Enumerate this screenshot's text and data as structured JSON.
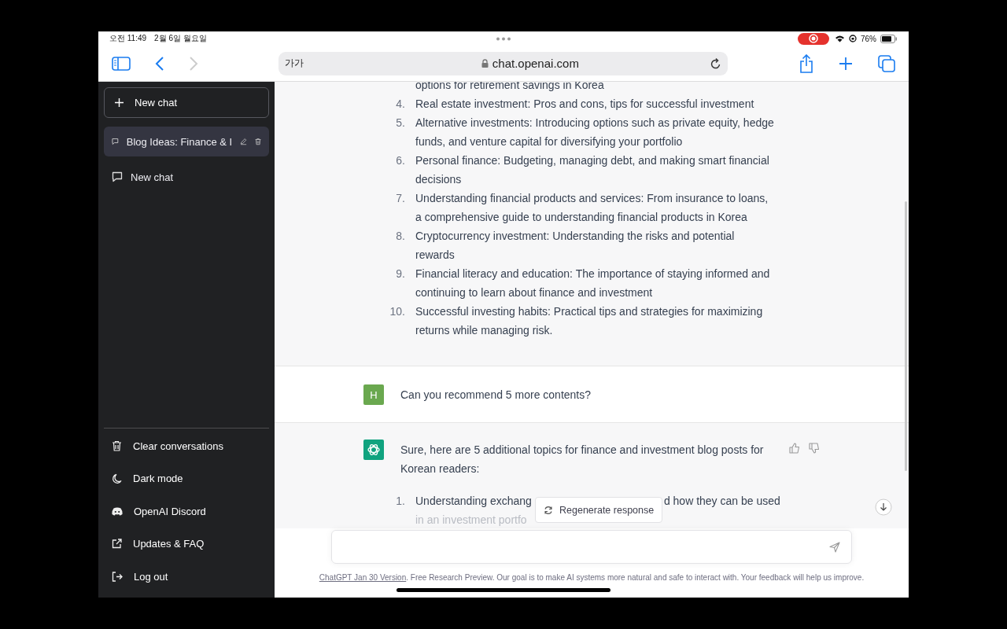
{
  "status_bar": {
    "time": "오전 11:49",
    "date": "2월 6일 월요일",
    "battery": "76%",
    "recording": true
  },
  "browser": {
    "text_size": "가가",
    "url": "chat.openai.com"
  },
  "sidebar": {
    "new_chat": "New chat",
    "chats": [
      {
        "title": "Blog Ideas: Finance & I",
        "selected": true
      },
      {
        "title": "New chat",
        "selected": false
      }
    ],
    "menu": [
      {
        "label": "Clear conversations",
        "kind": "trash"
      },
      {
        "label": "Dark mode",
        "kind": "moon"
      },
      {
        "label": "OpenAI Discord",
        "kind": "discord"
      },
      {
        "label": "Updates & FAQ",
        "kind": "external"
      },
      {
        "label": "Log out",
        "kind": "logout"
      }
    ]
  },
  "conversation": {
    "earlier_list": [
      {
        "text": "options for retirement savings in Korea"
      },
      {
        "number": "4.",
        "text": "Real estate investment: Pros and cons, tips for successful investment"
      },
      {
        "number": "5.",
        "text": "Alternative investments: Introducing options such as private equity, hedge funds, and venture capital for diversifying your portfolio"
      },
      {
        "number": "6.",
        "text": "Personal finance: Budgeting, managing debt, and making smart financial decisions"
      },
      {
        "number": "7.",
        "text": "Understanding financial products and services: From insurance to loans, a comprehensive guide to understanding financial products in Korea"
      },
      {
        "number": "8.",
        "text": "Cryptocurrency investment: Understanding the risks and potential rewards"
      },
      {
        "number": "9.",
        "text": "Financial literacy and education: The importance of staying informed and continuing to learn about finance and investment"
      },
      {
        "number": "10.",
        "text": "Successful investing habits: Practical tips and strategies for maximizing returns while managing risk."
      }
    ],
    "user_message": {
      "avatar": "H",
      "text": "Can you recommend 5 more contents?"
    },
    "reply": {
      "text": "Sure, here are 5 additional topics for finance and investment blog posts for Korean readers:",
      "list": [
        {
          "number": "1.",
          "parts": [
            "Understanding exchang",
            "d how they can be used"
          ],
          "continuation": "in an investment portfo"
        }
      ]
    },
    "regenerate": "Regenerate response",
    "footer": {
      "link": "ChatGPT Jan 30 Version",
      "text": ". Free Research Preview. Our goal is to make AI systems more natural and safe to interact with. Your feedback will help us improve."
    }
  }
}
